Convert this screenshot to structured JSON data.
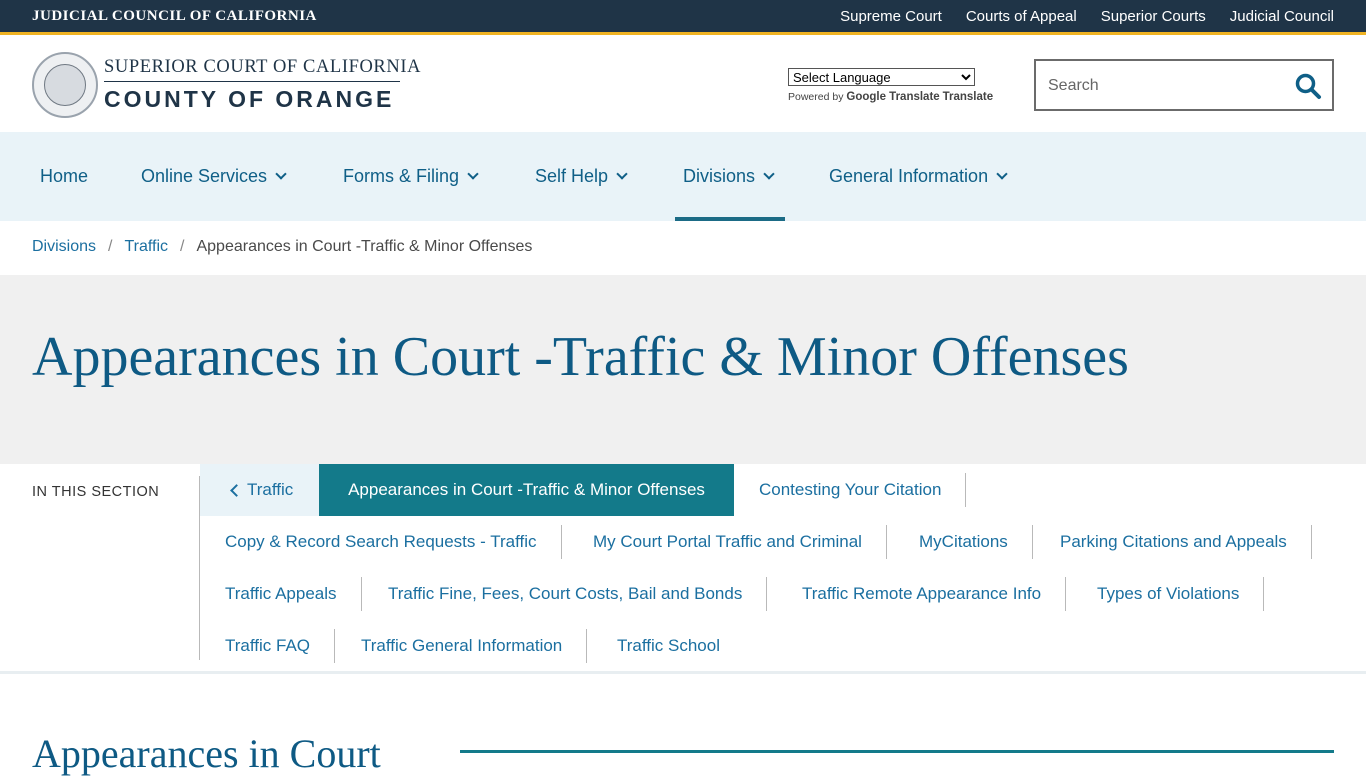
{
  "topbar": {
    "title": "JUDICIAL COUNCIL OF CALIFORNIA",
    "links": [
      "Supreme Court",
      "Courts of Appeal",
      "Superior Courts",
      "Judicial Council"
    ]
  },
  "header": {
    "brand_line1": "SUPERIOR COURT OF CALIFORNIA",
    "brand_line2": "COUNTY OF ORANGE",
    "language_select": "Select Language",
    "powered_by": "Powered by",
    "translate_text": "Google Translate",
    "translate_link": "Translate",
    "search_placeholder": "Search"
  },
  "nav": {
    "items": [
      {
        "label": "Home"
      },
      {
        "label": "Online Services"
      },
      {
        "label": "Forms & Filing"
      },
      {
        "label": "Self Help"
      },
      {
        "label": "Divisions"
      },
      {
        "label": "General Information"
      }
    ]
  },
  "breadcrumb": {
    "items": [
      "Divisions",
      "Traffic",
      "Appearances in Court -Traffic & Minor Offenses"
    ]
  },
  "page": {
    "title": "Appearances in Court -Traffic & Minor Offenses",
    "subhead": "Appearances in Court"
  },
  "section": {
    "label": "IN THIS SECTION",
    "back": "Traffic",
    "current": "Appearances in Court -Traffic & Minor Offenses",
    "links": [
      "Contesting Your Citation",
      "Copy & Record Search Requests - Traffic",
      "My Court Portal Traffic and Criminal",
      "MyCitations",
      "Parking Citations and Appeals",
      "Traffic Appeals",
      "Traffic Fine, Fees, Court Costs, Bail and Bonds",
      "Traffic Remote Appearance Info",
      "Types of Violations",
      "Traffic FAQ",
      "Traffic General Information",
      "Traffic School"
    ]
  },
  "colors": {
    "topbar": "#1f3447",
    "accent": "#f0b323",
    "link": "#1b6fa0",
    "current_bg": "#137a8a",
    "title": "#0e5a84"
  }
}
